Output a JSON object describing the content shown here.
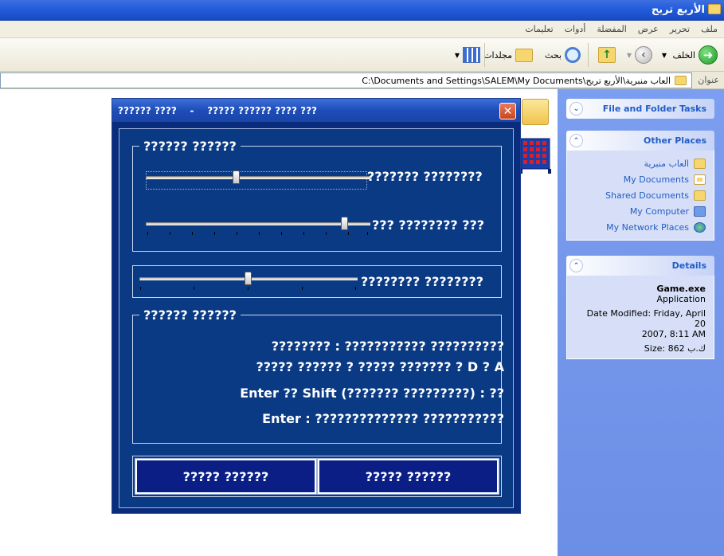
{
  "window": {
    "title": "الأربع تربح"
  },
  "menu": {
    "items": [
      "ملف",
      "تحرير",
      "عرض",
      "المفضلة",
      "أدوات",
      "تعليمات"
    ]
  },
  "toolbar": {
    "back_label": "الخلف",
    "search_label": "بحث",
    "folders_label": "مجلدات"
  },
  "address": {
    "label": "عنوان",
    "path": "C:\\Documents and Settings\\SALEM\\My Documents\\العاب منبرية\\الأربع تربح"
  },
  "taskpane": {
    "file_tasks_title": "File and Folder Tasks",
    "other_places_title": "Other Places",
    "other_places": [
      {
        "label": "العاب منبرية",
        "icon": "folder-icon"
      },
      {
        "label": "My Documents",
        "icon": "my-documents-icon"
      },
      {
        "label": "Shared Documents",
        "icon": "folder-icon"
      },
      {
        "label": "My Computer",
        "icon": "computer-icon"
      },
      {
        "label": "My Network Places",
        "icon": "network-icon"
      }
    ],
    "details_title": "Details",
    "details": {
      "name": "Game.exe",
      "type": "Application",
      "modified_line1": "Date Modified: Friday, April 20",
      "modified_line2": "2007, 8:11 AM",
      "size": "Size: 862 ك.ب"
    }
  },
  "dialog": {
    "title": "?????? ????    -    ????? ?????? ???? ???",
    "close_symbol": "✕",
    "group1": {
      "legend": "?????? ??????",
      "row1_label": "??????? ????????",
      "row1_value": 0.4,
      "row2_label": "??? ???????? ???",
      "row2_value": 0.9
    },
    "row3_label": "???????? ????????",
    "row3_value": 0.5,
    "group2": {
      "legend": "?????? ??????",
      "lines": [
        "???????? : ??????????? ??????????",
        "????? ?????? ? ????? ??????? ? D ? A",
        "Enter ?? Shift (??????? ?????????) : ??",
        "Enter : ?????????????? ???????????"
      ]
    },
    "buttons": {
      "left": "????? ??????",
      "right": "????? ??????"
    }
  },
  "colors": {
    "dialog_bg": "#0b3a84",
    "button_bg": "#0a1e86",
    "taskpane_bg": "#7b9ef0",
    "link": "#215dc6"
  }
}
